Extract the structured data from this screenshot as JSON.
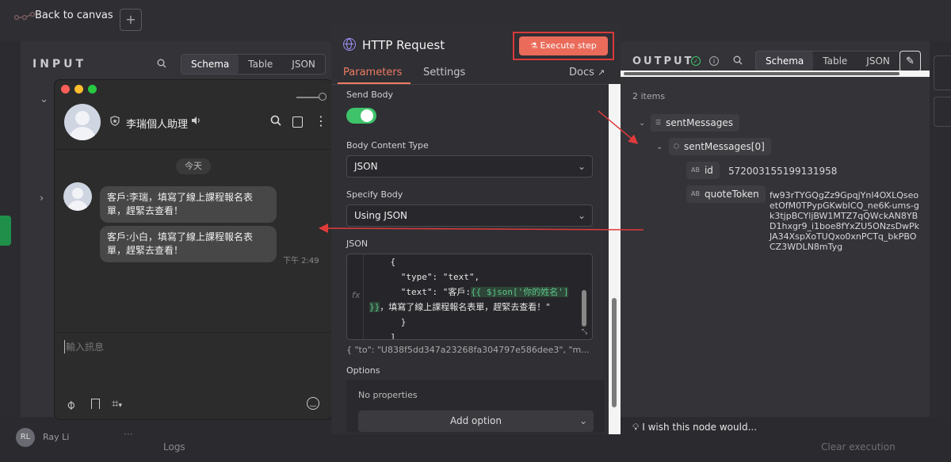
{
  "canvas": {
    "back_label": "Back to canvas",
    "logo_text": "n8n",
    "plus_label": "+",
    "user_initials": "RL",
    "user_name": "Ray Li",
    "user_more": "···",
    "logs_label": "Logs",
    "clear_execution_label": "Clear execution"
  },
  "input_panel": {
    "title": "INPUT",
    "tabs": [
      "Schema",
      "Table",
      "JSON"
    ],
    "active_tab": "Schema"
  },
  "chat": {
    "contact_name": "李瑞個人助理",
    "date_chip": "今天",
    "messages": [
      "客戶:李瑞，填寫了線上課程報名表單，趕緊去查看！",
      "客戶:小白，填寫了線上課程報名表單，趕緊去查看！"
    ],
    "time": "下午 2:49",
    "input_placeholder": "輸入訊息"
  },
  "http": {
    "title": "HTTP Request",
    "execute_label": "Execute step",
    "tabs": {
      "parameters": "Parameters",
      "settings": "Settings",
      "docs": "Docs"
    },
    "send_body_label": "Send Body",
    "send_body_on": true,
    "body_content_type_label": "Body Content Type",
    "body_content_type_value": "JSON",
    "specify_body_label": "Specify Body",
    "specify_body_value": "Using JSON",
    "json_label": "JSON",
    "fx_label": "fx",
    "code": {
      "line1": "    {",
      "line2": "      \"type\": \"text\",",
      "line3_prefix": "      \"text\": \"客戶:",
      "line3_expr": "{{ $json['你的姓名']",
      "line4_expr": "}}",
      "line4_suffix": "，填寫了線上課程報名表單，趕緊去查看！\"",
      "line5": "      }",
      "line6": "    ]"
    },
    "json_preview": "{   \"to\": \"U838f5dd347a23268fa304797e586dee3\",   \"m...",
    "options_label": "Options",
    "no_properties": "No properties",
    "add_option_label": "Add option"
  },
  "output": {
    "title": "OUTPUT",
    "tabs": [
      "Schema",
      "Table",
      "JSON"
    ],
    "active_tab": "Schema",
    "items_count": "2 items",
    "tree": {
      "sent_key": "sentMessages",
      "sent0_key": "sentMessages[0]",
      "id_key": "id",
      "id_value": "572003155199131958",
      "quote_key": "quoteToken",
      "quote_value": "fw93rTYGQgZz9GpqjYnI4OXLQseoetOfM0TPypGKwbICQ_ne6K-ums-gk3tjpBCYljBW1MTZ7qQWckAN8YBD1hxgr9_i1boe8fYxZU5ONzsDwPkJA34XspXoTUQxo0xnPCTq_bkPBOCZ3WDLN8mTyg"
    },
    "feedback_label": "I wish this node would..."
  },
  "icons": {
    "search": "search-icon",
    "check": "success-check-icon",
    "info": "info-icon",
    "edit": "pencil-icon",
    "globe": "globe-icon",
    "flask": "flask-icon"
  },
  "colors": {
    "accent": "#ea6b5a",
    "toggle_on": "#3ec26a",
    "annotation_red": "#d83a3a"
  }
}
